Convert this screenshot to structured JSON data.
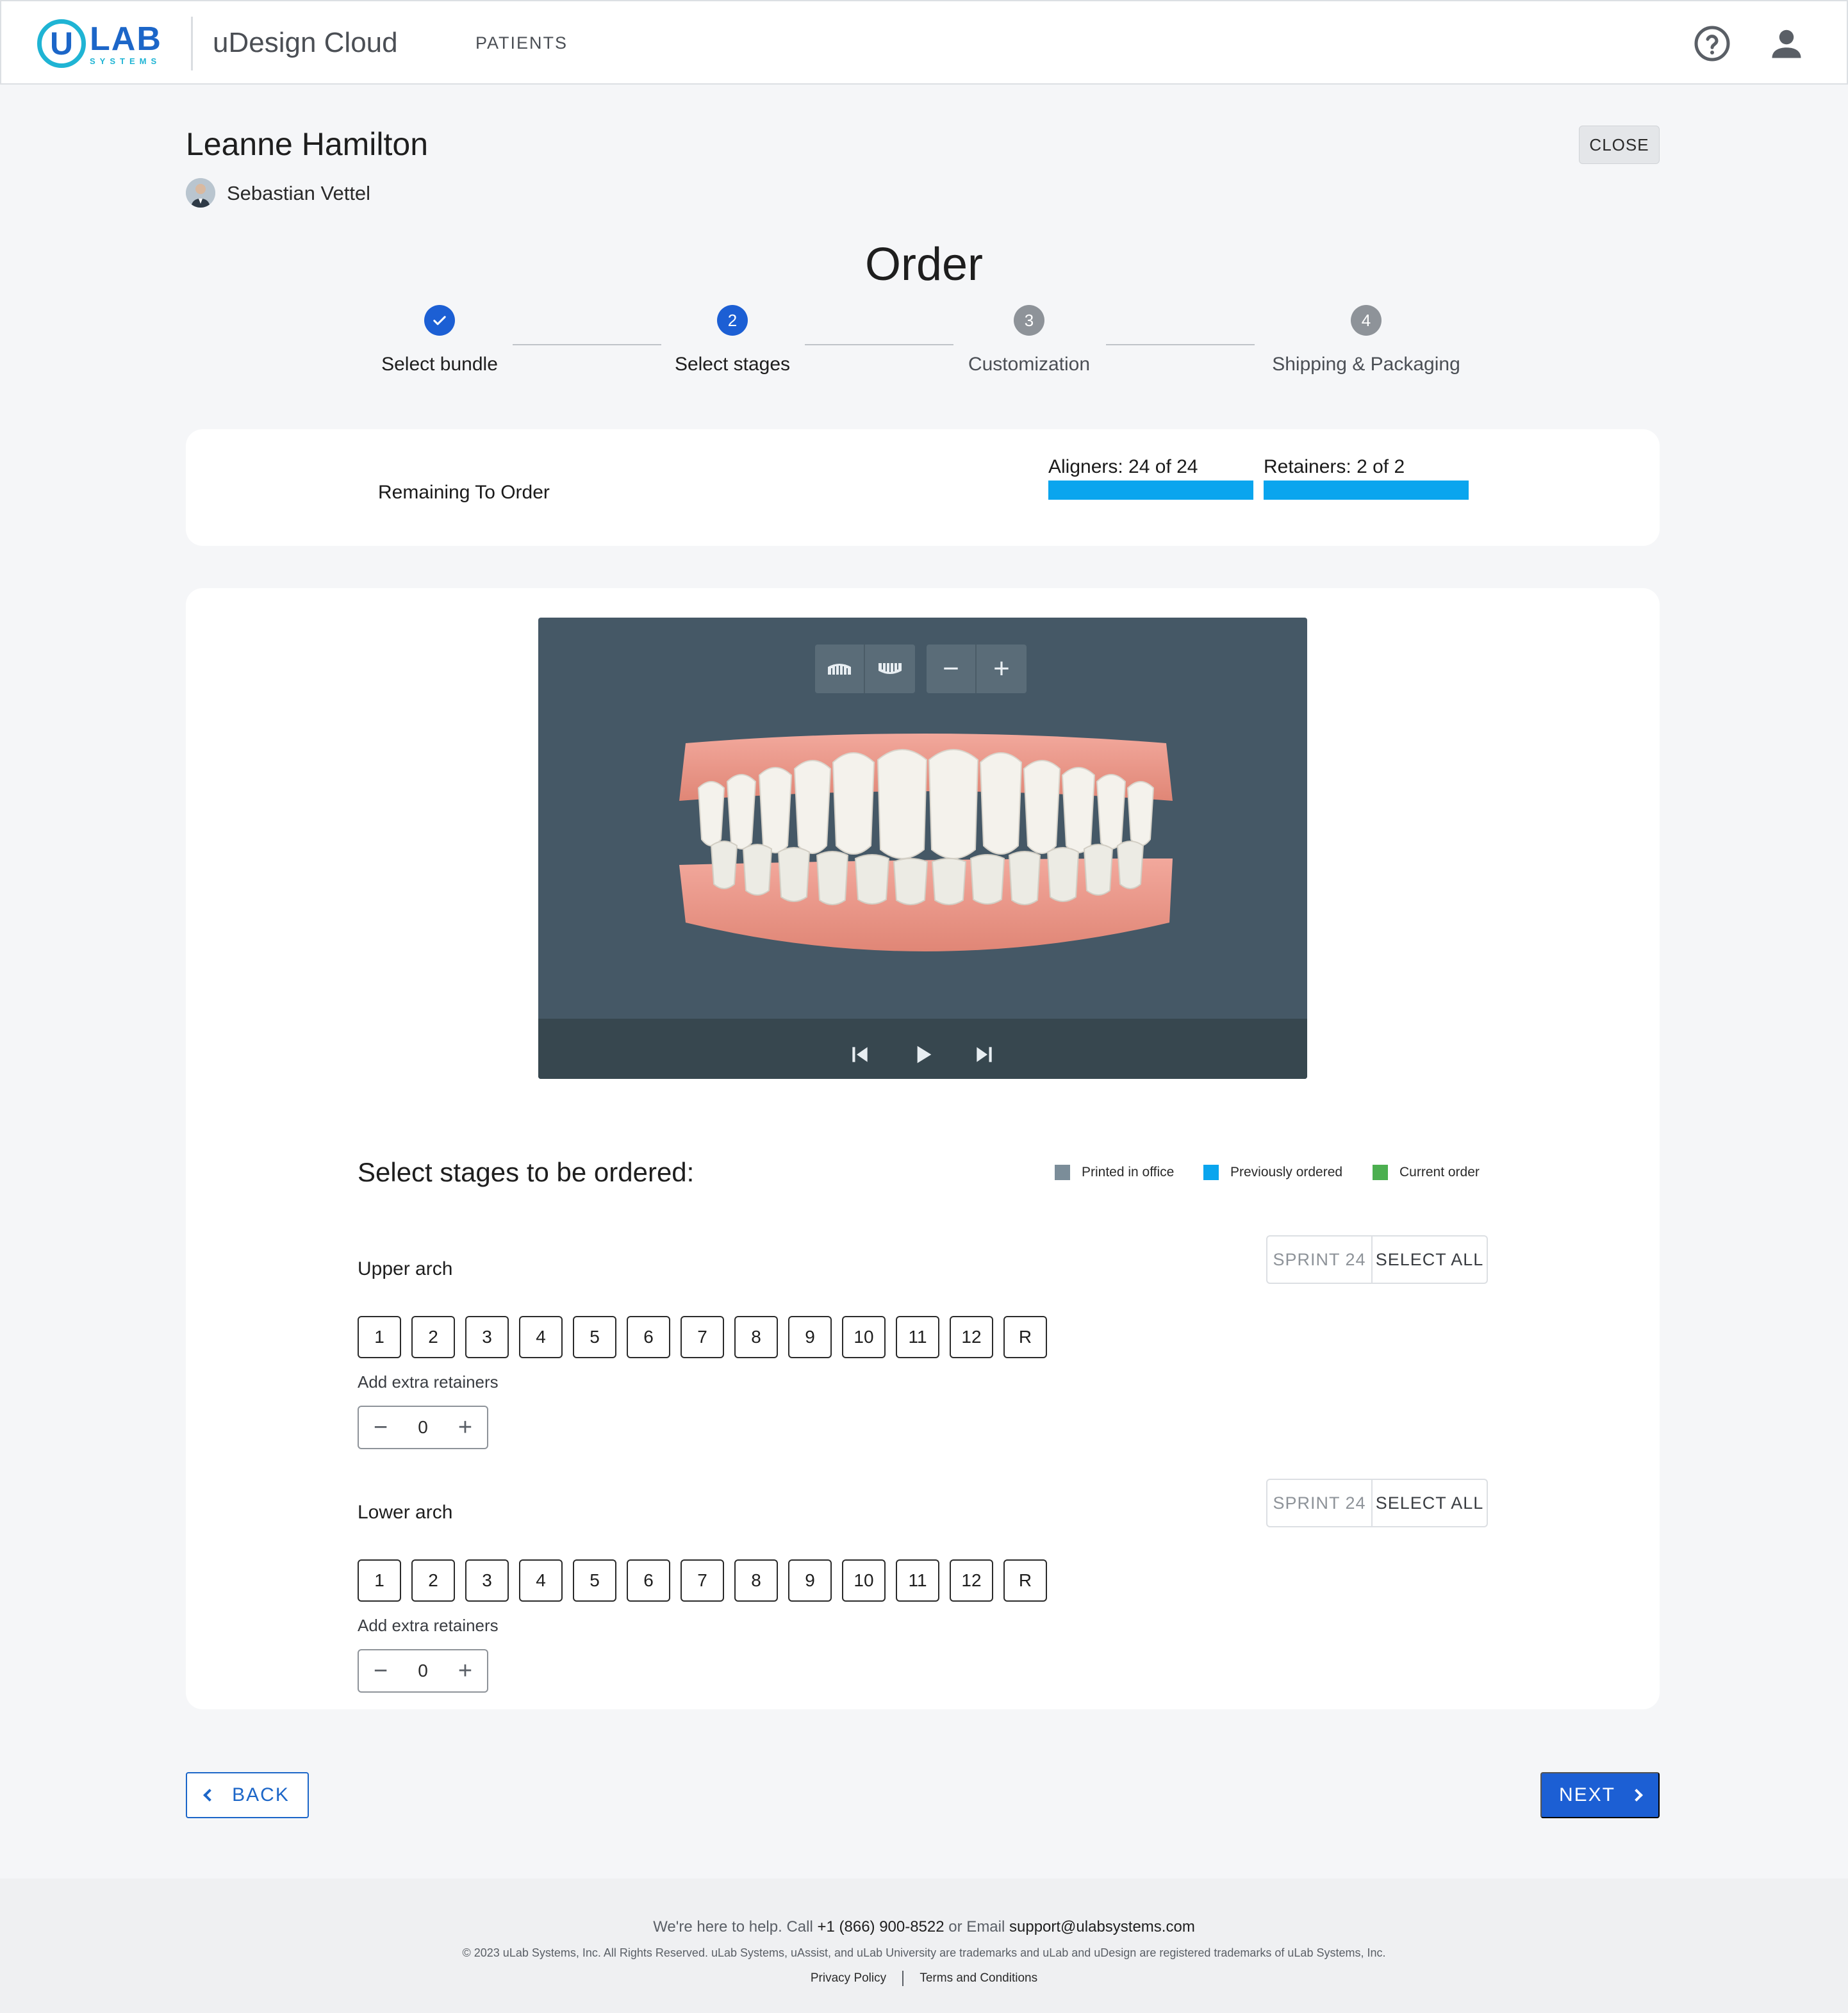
{
  "header": {
    "logo_main": "LAB",
    "logo_u": "U",
    "logo_sub": "SYSTEMS",
    "app_title": "uDesign Cloud",
    "nav_patients": "PATIENTS",
    "help_icon": "help-circle-icon",
    "user_icon": "account-icon"
  },
  "patient": {
    "name": "Leanne Hamilton",
    "doctor": "Sebastian Vettel",
    "close_label": "CLOSE"
  },
  "page_title": "Order",
  "steps": [
    {
      "number": "",
      "label": "Select bundle",
      "state": "completed"
    },
    {
      "number": "2",
      "label": "Select stages",
      "state": "active"
    },
    {
      "number": "3",
      "label": "Customization",
      "state": "pending"
    },
    {
      "number": "4",
      "label": "Shipping & Packaging",
      "state": "pending"
    }
  ],
  "remaining": {
    "label": "Remaining To Order",
    "aligners_label": "Aligners: 24 of 24",
    "aligners_fraction": 1.0,
    "retainers_label": "Retainers: 2 of 2",
    "retainers_fraction": 1.0
  },
  "viewer": {
    "toolbar_icons": [
      "upper-arch-icon",
      "lower-arch-icon",
      "zoom-out-icon",
      "zoom-in-icon"
    ],
    "zoom_out": "−",
    "zoom_in": "+",
    "controls": [
      "skip-start-icon",
      "play-icon",
      "skip-end-icon"
    ]
  },
  "stages": {
    "title": "Select stages to be ordered:",
    "legend": [
      {
        "label": "Printed in office",
        "color": "#7b8d99"
      },
      {
        "label": "Previously ordered",
        "color": "#0aa5ee"
      },
      {
        "label": "Current order",
        "color": "#4caf50"
      }
    ],
    "upper": {
      "label": "Upper arch",
      "sprint": "SPRINT 24",
      "select_all": "SELECT ALL",
      "stages": [
        "1",
        "2",
        "3",
        "4",
        "5",
        "6",
        "7",
        "8",
        "9",
        "10",
        "11",
        "12",
        "R"
      ],
      "extra_label": "Add extra retainers",
      "extra_value": "0"
    },
    "lower": {
      "label": "Lower arch",
      "sprint": "SPRINT 24",
      "select_all": "SELECT ALL",
      "stages": [
        "1",
        "2",
        "3",
        "4",
        "5",
        "6",
        "7",
        "8",
        "9",
        "10",
        "11",
        "12",
        "R"
      ],
      "extra_label": "Add extra retainers",
      "extra_value": "0"
    },
    "minus": "−",
    "plus": "+"
  },
  "nav": {
    "back": "BACK",
    "next": "NEXT"
  },
  "footer": {
    "help_prefix": "We're here to help. Call",
    "phone": "+1 (866) 900-8522",
    "help_mid": "or Email",
    "email": "support@ulabsystems.com",
    "copyright": "© 2023 uLab Systems, Inc. All Rights Reserved. uLab Systems, uAssist, and uLab University are trademarks and uLab and uDesign are registered trademarks of uLab Systems, Inc.",
    "privacy": "Privacy Policy",
    "terms": "Terms and Conditions"
  },
  "colors": {
    "primary": "#1c5fd4",
    "progress": "#0aa5ee",
    "step_pending": "#8e9399"
  }
}
